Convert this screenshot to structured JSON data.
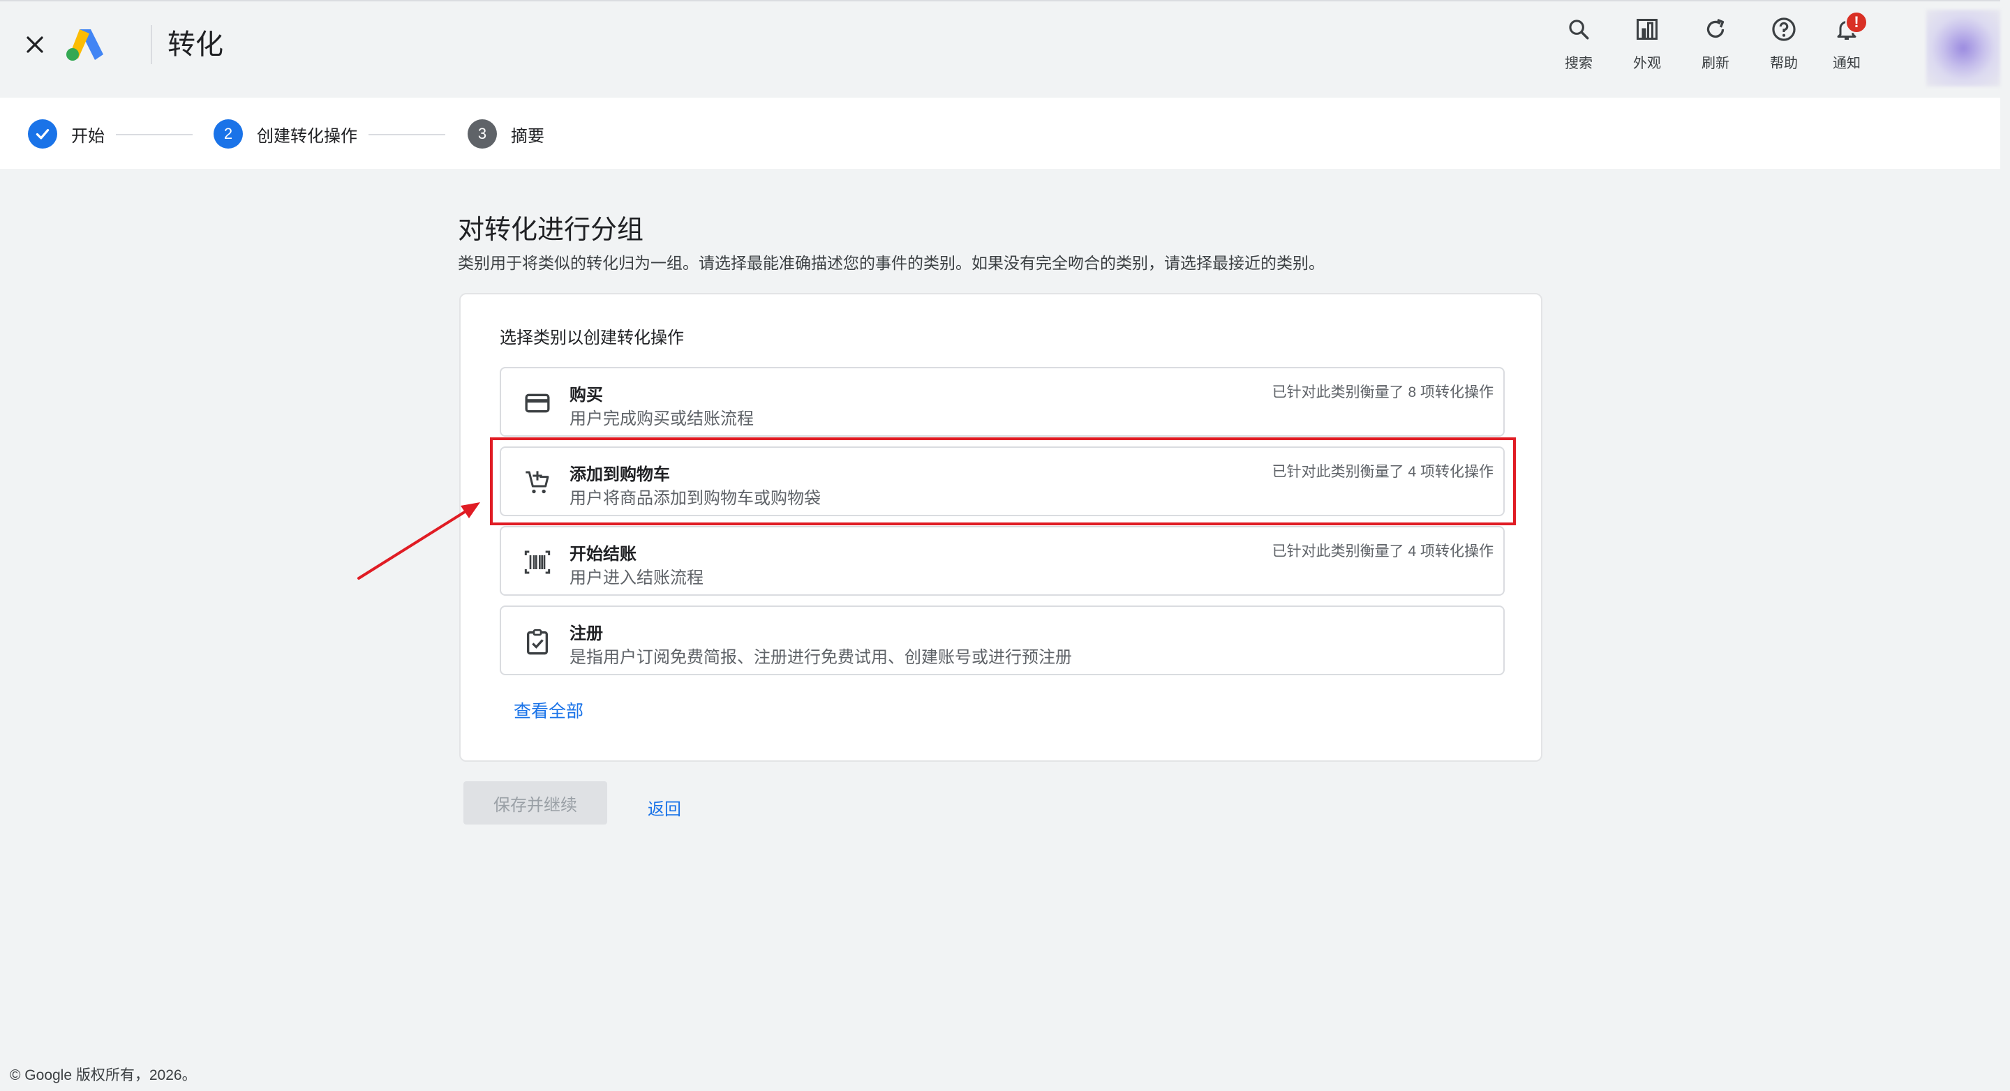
{
  "header": {
    "title": "转化",
    "tools": [
      {
        "name": "search",
        "label": "搜索",
        "icon": "search-icon"
      },
      {
        "name": "appearance",
        "label": "外观",
        "icon": "appearance-icon"
      },
      {
        "name": "refresh",
        "label": "刷新",
        "icon": "refresh-icon"
      },
      {
        "name": "help",
        "label": "帮助",
        "icon": "help-icon"
      },
      {
        "name": "notifications",
        "label": "通知",
        "icon": "bell-icon",
        "badge": "!"
      }
    ]
  },
  "stepper": {
    "steps": [
      {
        "label": "开始",
        "state": "done"
      },
      {
        "number": "2",
        "label": "创建转化操作",
        "state": "active"
      },
      {
        "number": "3",
        "label": "摘要",
        "state": "pending"
      }
    ]
  },
  "main": {
    "heading": "对转化进行分组",
    "description": "类别用于将类似的转化归为一组。请选择最能准确描述您的事件的类别。如果没有完全吻合的类别，请选择最接近的类别。",
    "card": {
      "title": "选择类别以创建转化操作",
      "options": [
        {
          "title": "购买",
          "description": "用户完成购买或结账流程",
          "meta": "已针对此类别衡量了 8 项转化操作",
          "icon": "credit-card-icon"
        },
        {
          "title": "添加到购物车",
          "description": "用户将商品添加到购物车或购物袋",
          "meta": "已针对此类别衡量了 4 项转化操作",
          "icon": "cart-add-icon"
        },
        {
          "title": "开始结账",
          "description": "用户进入结账流程",
          "meta": "已针对此类别衡量了 4 项转化操作",
          "icon": "barcode-icon"
        },
        {
          "title": "注册",
          "description": "是指用户订阅免费简报、注册进行免费试用、创建账号或进行预注册",
          "meta": "",
          "icon": "clipboard-check-icon"
        }
      ],
      "view_all": "查看全部"
    },
    "save_button": "保存并继续",
    "back_button": "返回"
  },
  "footer": {
    "copyright": "© Google 版权所有，2026。"
  },
  "colors": {
    "accent": "#1a73e8",
    "highlight": "#e01c24",
    "background": "#f1f3f4"
  }
}
